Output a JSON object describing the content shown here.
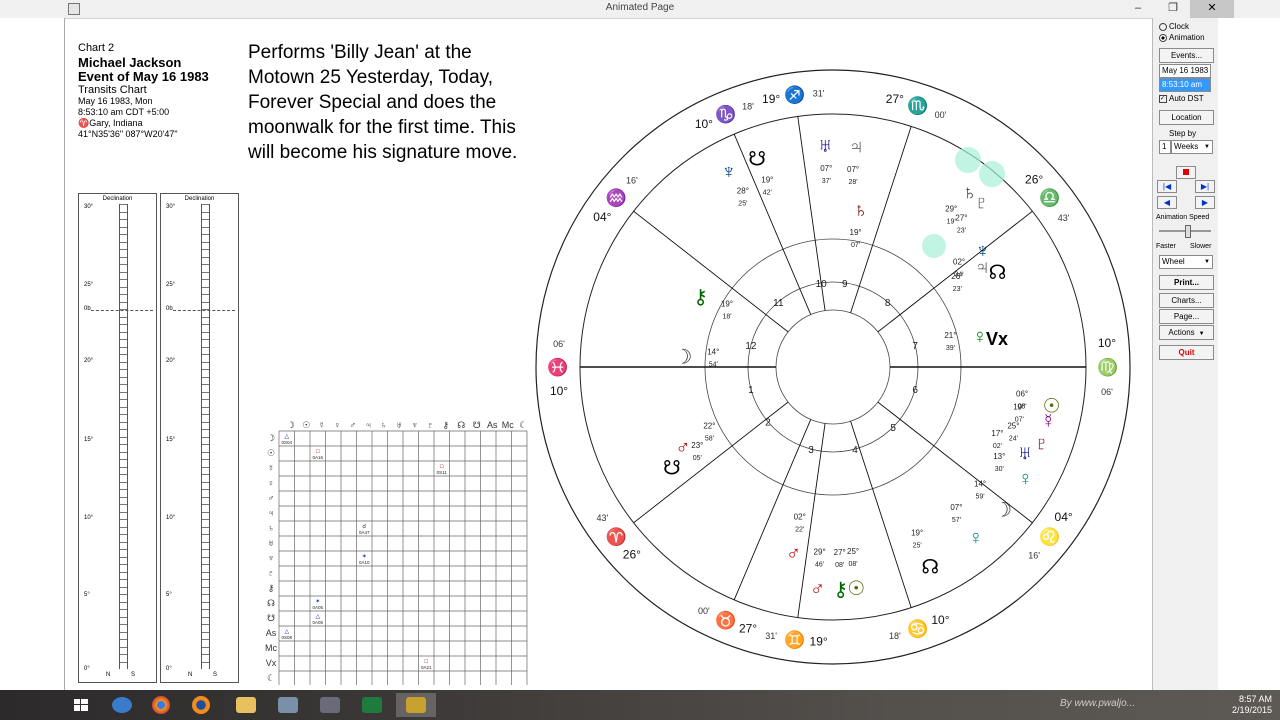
{
  "window": {
    "title": "Animated Page",
    "minimize": "–",
    "restore": "❐",
    "close": "✕"
  },
  "chart": {
    "label": "Chart 2",
    "name": "Michael Jackson",
    "event": "Event of May 16 1983",
    "type": "Transits Chart",
    "date": "May 16 1983, Mon",
    "time": "8:53:10 am  CDT +5:00",
    "place": "♈Gary, Indiana",
    "coords": "41°N35'36\"  087°W20'47\""
  },
  "caption": "Performs 'Billy Jean' at the Motown 25 Yesterday, Today, Forever Special and does the moonwalk for the first time. This will become his signature move.",
  "declination": {
    "header": "Declination",
    "ticks": [
      "30°",
      "25°",
      "0b",
      "20°",
      "15°",
      "10°",
      "5°",
      "0°"
    ],
    "ns": [
      "N",
      "S"
    ]
  },
  "aspect_grid": {
    "header": [
      "☽",
      "☉",
      "☿",
      "♀",
      "♂",
      "♃",
      "♄",
      "♅",
      "♆",
      "♇",
      "⚷",
      "☊",
      "☋",
      "As",
      "Mc",
      "☾"
    ],
    "rows": [
      "☽",
      "☉",
      "☿",
      "♀",
      "♂",
      "♃",
      "♄",
      "♅",
      "♆",
      "♇",
      "⚷",
      "☊",
      "☋",
      "As",
      "Mc",
      "Vx",
      "☾"
    ],
    "cells": [
      {
        "r": 0,
        "c": 0,
        "g": "△",
        "v": "0S04"
      },
      {
        "r": 1,
        "c": 2,
        "g": "□",
        "v": "0A16"
      },
      {
        "r": 2,
        "c": 10,
        "g": "□",
        "v": "0S11"
      },
      {
        "r": 6,
        "c": 5,
        "g": "☌",
        "v": "0A47"
      },
      {
        "r": 8,
        "c": 5,
        "g": "✶",
        "v": "0A10"
      },
      {
        "r": 11,
        "c": 2,
        "g": "✶",
        "v": "0A05"
      },
      {
        "r": 12,
        "c": 2,
        "g": "△",
        "v": "0A05"
      },
      {
        "r": 13,
        "c": 0,
        "g": "△",
        "v": "0S08"
      },
      {
        "r": 15,
        "c": 9,
        "g": "□",
        "v": "0A21"
      }
    ]
  },
  "wheel": {
    "cusps_outer": [
      {
        "deg": "19°",
        "sign": "♐",
        "min": "31'"
      },
      {
        "deg": "27°",
        "sign": "♏",
        "min": "00'"
      },
      {
        "deg": "26°",
        "sign": "♎",
        "min": "43'"
      },
      {
        "deg": "10°",
        "sign": "♍",
        "min": "06'"
      },
      {
        "deg": "04°",
        "sign": "♌",
        "min": "16'"
      },
      {
        "deg": "10°",
        "sign": "♋",
        "min": "18'"
      },
      {
        "deg": "19°",
        "sign": "♊",
        "min": "31'"
      },
      {
        "deg": "27°",
        "sign": "♉",
        "min": "00'"
      },
      {
        "deg": "26°",
        "sign": "♈",
        "min": "43'"
      },
      {
        "deg": "10°",
        "sign": "♓",
        "min": "06'"
      },
      {
        "deg": "04°",
        "sign": "♒",
        "min": "16'"
      },
      {
        "deg": "10°",
        "sign": "♑",
        "min": "18'"
      }
    ],
    "houses": [
      "1",
      "2",
      "3",
      "4",
      "5",
      "6",
      "7",
      "8",
      "9",
      "10",
      "11",
      "12"
    ],
    "vertex": "Vx",
    "planets": [
      {
        "glyph": "♆",
        "color": "#003f7f",
        "deg": "28°",
        "min": "25'"
      },
      {
        "glyph": "☋",
        "color": "#000",
        "deg": "19°",
        "min": "42'"
      },
      {
        "glyph": "♅",
        "color": "#00008b",
        "deg": "07°",
        "min": "37'"
      },
      {
        "glyph": "♃",
        "color": "#555",
        "deg": "07°",
        "min": "28'"
      },
      {
        "glyph": "♄",
        "color": "#7a0000",
        "deg": "19°",
        "min": "07'"
      },
      {
        "glyph": "♄",
        "color": "#333",
        "deg": "29°",
        "min": "19'"
      },
      {
        "glyph": "♇",
        "color": "#555",
        "deg": "27°",
        "min": "23'"
      },
      {
        "glyph": "♆",
        "color": "#003f7f",
        "deg": "02°",
        "min": "34'"
      },
      {
        "glyph": "♃",
        "color": "#555",
        "deg": "26°",
        "min": "23'"
      },
      {
        "glyph": "☊",
        "color": "#000",
        "deg": "",
        "min": ""
      },
      {
        "glyph": "♀",
        "color": "#008000",
        "deg": "21°",
        "min": "39'"
      },
      {
        "glyph": "⚷",
        "color": "#006400",
        "deg": "19°",
        "min": "18'"
      },
      {
        "glyph": "☽",
        "color": "#333",
        "deg": "14°",
        "min": "54'"
      },
      {
        "glyph": "♂",
        "color": "#c00000",
        "deg": "22°",
        "min": "58'"
      },
      {
        "glyph": "☋",
        "color": "#000",
        "deg": "23°",
        "min": "05'"
      },
      {
        "glyph": "♂",
        "color": "#c00000",
        "deg": "02°",
        "min": "22'"
      },
      {
        "glyph": "☉",
        "color": "#556b00",
        "deg": "06°",
        "min": "08'"
      },
      {
        "glyph": "♇",
        "color": "#7a0044",
        "deg": "25°",
        "min": "24'"
      },
      {
        "glyph": "♀",
        "color": "#008b8b",
        "deg": "13°",
        "min": "30'"
      },
      {
        "glyph": "♅",
        "color": "#00008b",
        "deg": "17°",
        "min": "02'"
      },
      {
        "glyph": "☿",
        "color": "#800080",
        "deg": "19°",
        "min": "07'"
      },
      {
        "glyph": "☉",
        "color": "#556b00",
        "deg": "25°",
        "min": "08'"
      },
      {
        "glyph": "⚷",
        "color": "#006400",
        "deg": "27°",
        "min": "08'"
      },
      {
        "glyph": "♂",
        "color": "#c00000",
        "deg": "29°",
        "min": "46'"
      },
      {
        "glyph": "☊",
        "color": "#000",
        "deg": "19°",
        "min": "25'"
      },
      {
        "glyph": "♀",
        "color": "#008b8b",
        "deg": "07°",
        "min": "57'"
      },
      {
        "glyph": "☽",
        "color": "#333",
        "deg": "14°",
        "min": "59'"
      }
    ]
  },
  "controls": {
    "clock": "Clock",
    "animation": "Animation",
    "events": "Events...",
    "date": "May 16 1983",
    "time": "8:53:10 am",
    "auto_dst": "Auto DST",
    "location": "Location",
    "step_by": "Step by",
    "step_value": "1",
    "step_unit": "Weeks",
    "anim_speed": "Animation Speed",
    "faster": "Faster",
    "slower": "Slower",
    "wheel": "Wheel",
    "print": "Print...",
    "charts": "Charts...",
    "page": "Page...",
    "actions": "Actions",
    "quit": "Quit"
  },
  "taskbar": {
    "time": "8:57 AM",
    "date": "2/19/2015",
    "watermark": "By www.pwaljo..."
  }
}
